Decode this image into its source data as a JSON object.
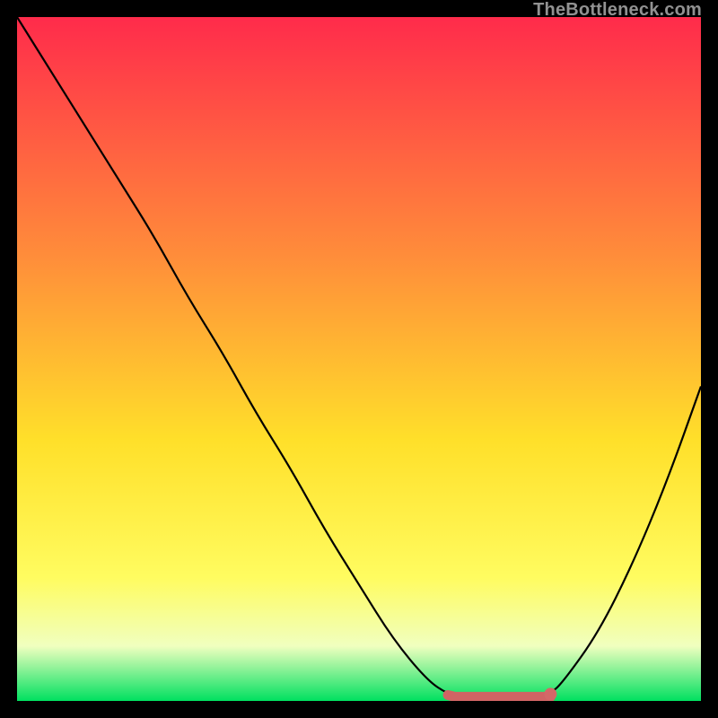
{
  "watermark": "TheBottleneck.com",
  "colors": {
    "gradient_top": "#ff2b4b",
    "gradient_mid_upper": "#ff8d3a",
    "gradient_mid": "#ffe02a",
    "gradient_lower_yellow": "#fffc60",
    "gradient_pale": "#f0ffbf",
    "gradient_green": "#00e060",
    "curve": "#000000",
    "marker_stroke": "#d16464",
    "marker_fill": "#d46868"
  },
  "chart_data": {
    "type": "line",
    "title": "",
    "xlabel": "",
    "ylabel": "",
    "xlim": [
      0,
      100
    ],
    "ylim": [
      0,
      100
    ],
    "series": [
      {
        "name": "bottleneck-curve",
        "x": [
          0,
          5,
          10,
          15,
          20,
          25,
          30,
          35,
          40,
          45,
          50,
          55,
          60,
          63,
          66,
          70,
          74,
          78,
          80,
          85,
          90,
          95,
          100
        ],
        "y": [
          100,
          92,
          84,
          76,
          68,
          59,
          51,
          42,
          34,
          25,
          17,
          9,
          3,
          1,
          0,
          0,
          0,
          1,
          3,
          10,
          20,
          32,
          46
        ]
      }
    ],
    "optimal_marker": {
      "x_range": [
        63,
        78
      ],
      "x_dot": 78,
      "y": 0.6
    },
    "gradient_stops": [
      {
        "offset": 0.0,
        "color": "#ff2b4b"
      },
      {
        "offset": 0.35,
        "color": "#ff8d3a"
      },
      {
        "offset": 0.62,
        "color": "#ffe02a"
      },
      {
        "offset": 0.82,
        "color": "#fffc60"
      },
      {
        "offset": 0.92,
        "color": "#f0ffbf"
      },
      {
        "offset": 1.0,
        "color": "#00e060"
      }
    ]
  }
}
